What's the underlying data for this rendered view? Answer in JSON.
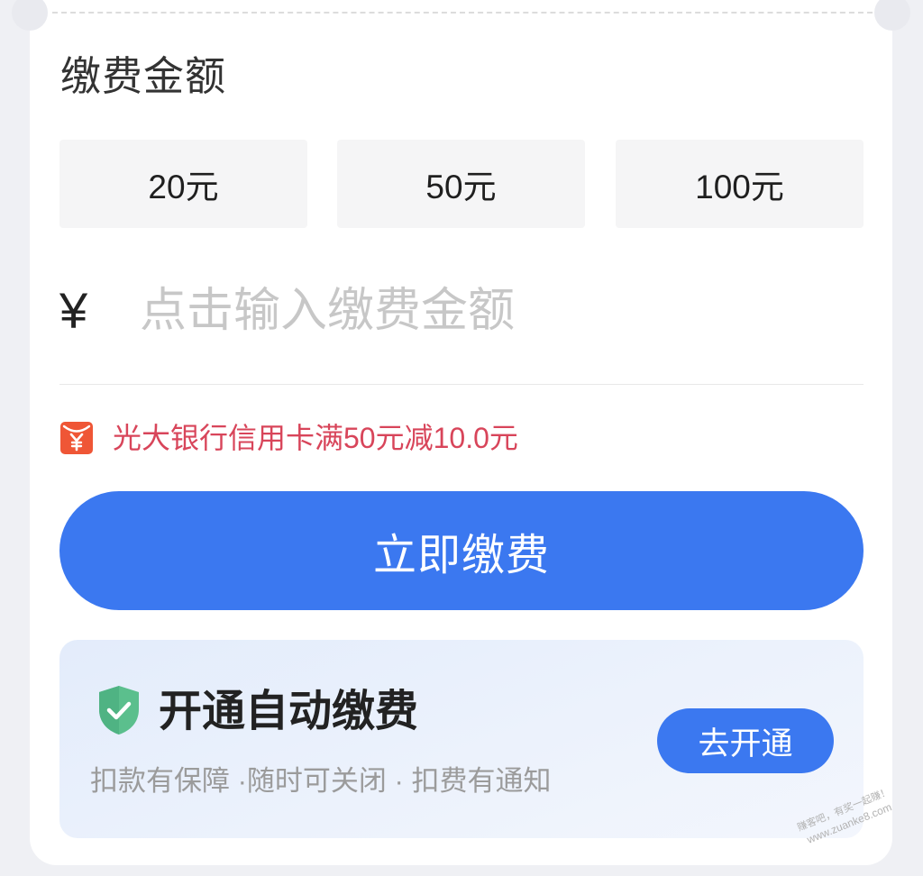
{
  "section_title": "缴费金额",
  "amount_options": [
    {
      "label": "20元"
    },
    {
      "label": "50元"
    },
    {
      "label": "100元"
    }
  ],
  "amount_input": {
    "currency_symbol": "¥",
    "placeholder": "点击输入缴费金额"
  },
  "promo": {
    "icon": "red-envelope-yuan-icon",
    "text": "光大银行信用卡满50元减10.0元",
    "color": "#d8455a"
  },
  "pay_button": {
    "label": "立即缴费",
    "color": "#3b78f0"
  },
  "auto_pay": {
    "icon": "shield-check-icon",
    "icon_color": "#5bbf8d",
    "title": "开通自动缴费",
    "subtitle": "扣款有保障 ·随时可关闭 · 扣费有通知",
    "button_label": "去开通"
  },
  "watermark": {
    "line1": "赚客吧，有奖一起赚！",
    "line2": "www.zuanke8.com"
  }
}
